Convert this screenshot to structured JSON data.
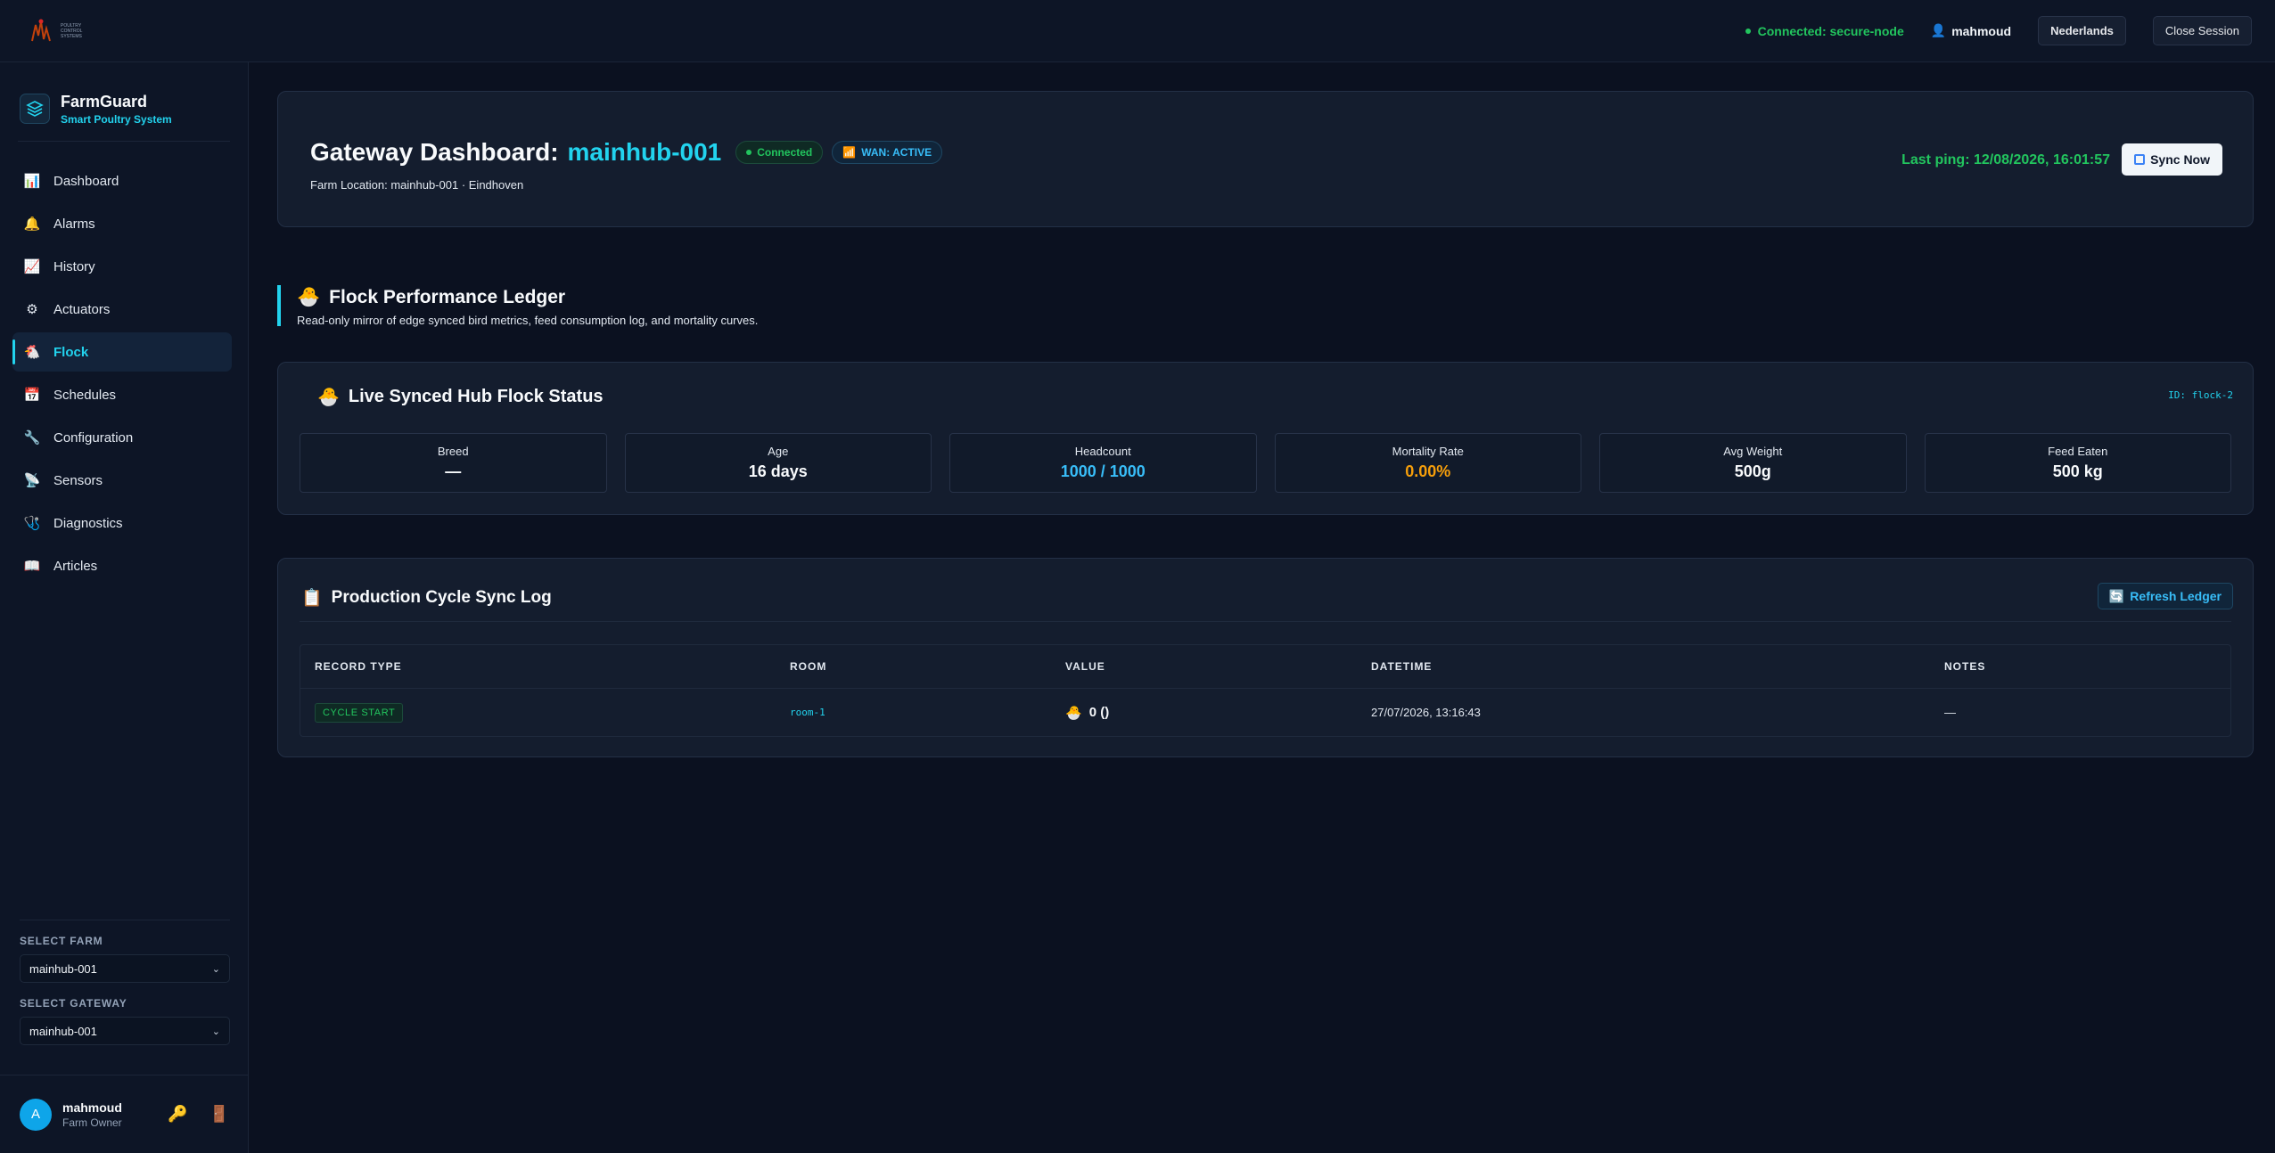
{
  "topbar": {
    "logo_small_text": "POULTRY CONTROL SYSTEMS",
    "connection": "Connected: secure-node",
    "user": "mahmoud",
    "language_button": "Nederlands",
    "close_button": "Close Session"
  },
  "sidebar": {
    "brand_title": "FarmGuard",
    "brand_subtitle": "Smart Poultry System",
    "items": [
      {
        "label": "Dashboard",
        "icon": "bar-chart-icon",
        "glyph": "📊"
      },
      {
        "label": "Alarms",
        "icon": "bell-icon",
        "glyph": "🔔"
      },
      {
        "label": "History",
        "icon": "trend-chart-icon",
        "glyph": "📈"
      },
      {
        "label": "Actuators",
        "icon": "gear-icon",
        "glyph": "⚙"
      },
      {
        "label": "Flock",
        "icon": "chicken-icon",
        "glyph": "🐔"
      },
      {
        "label": "Schedules",
        "icon": "calendar-icon",
        "glyph": "📅"
      },
      {
        "label": "Configuration",
        "icon": "wrench-icon",
        "glyph": "🔧"
      },
      {
        "label": "Sensors",
        "icon": "satellite-icon",
        "glyph": "📡"
      },
      {
        "label": "Diagnostics",
        "icon": "stethoscope-icon",
        "glyph": "🩺"
      },
      {
        "label": "Articles",
        "icon": "book-icon",
        "glyph": "📖"
      }
    ],
    "active_item": "Flock",
    "select_farm_label": "SELECT FARM",
    "select_farm_value": "mainhub-001",
    "select_gateway_label": "SELECT GATEWAY",
    "select_gateway_value": "mainhub-001",
    "user_initial": "A",
    "user_name": "mahmoud",
    "user_role": "Farm Owner"
  },
  "header": {
    "title_prefix": "Gateway Dashboard:",
    "hub_name": "mainhub-001",
    "connected_badge": "Connected",
    "wan_badge": "WAN: ACTIVE",
    "farm_location": "Farm Location: mainhub-001 · Eindhoven",
    "last_ping": "Last ping: 12/08/2026, 16:01:57",
    "sync_button": "Sync Now"
  },
  "ledger": {
    "title": "Flock Performance Ledger",
    "subtitle": "Read-only mirror of edge synced bird metrics, feed consumption log, and mortality curves."
  },
  "flock_status": {
    "title": "Live Synced Hub Flock Status",
    "id": "ID: flock-2",
    "metrics": [
      {
        "label": "Breed",
        "value": "—"
      },
      {
        "label": "Age",
        "value": "16 days"
      },
      {
        "label": "Headcount",
        "value": "1000 / 1000"
      },
      {
        "label": "Mortality Rate",
        "value": "0.00%"
      },
      {
        "label": "Avg Weight",
        "value": "500g"
      },
      {
        "label": "Feed Eaten",
        "value": "500 kg"
      }
    ]
  },
  "sync_log": {
    "title": "Production Cycle Sync Log",
    "refresh_button": "Refresh Ledger",
    "columns": [
      "RECORD TYPE",
      "ROOM",
      "VALUE",
      "DATETIME",
      "NOTES"
    ],
    "rows": [
      {
        "record_type": "CYCLE START",
        "room": "room-1",
        "value": "0 ()",
        "datetime": "27/07/2026, 13:16:43",
        "notes": "—"
      }
    ]
  },
  "colors": {
    "accent": "#22d3ee",
    "success": "#22c55e",
    "warning": "#f59e0b",
    "background": "#0b1120"
  }
}
